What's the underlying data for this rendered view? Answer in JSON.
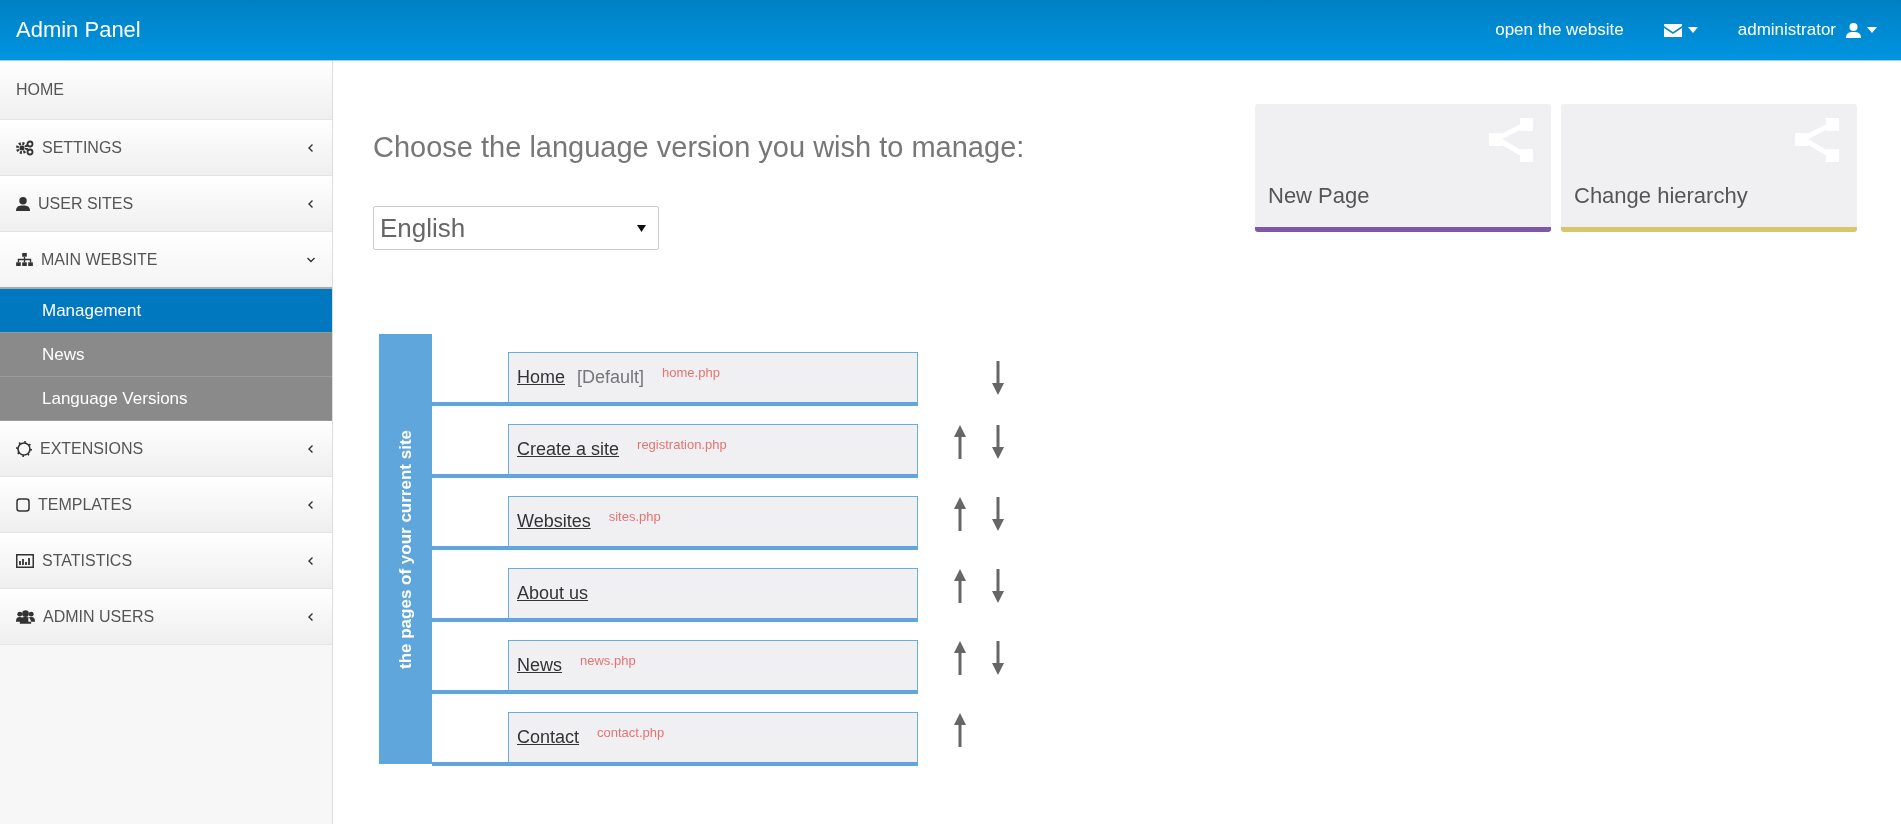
{
  "topbar": {
    "title": "Admin Panel",
    "website_link": "open the website",
    "user": "administrator"
  },
  "sidebar": {
    "items": [
      {
        "label": "HOME"
      },
      {
        "label": "SETTINGS",
        "expanded": false
      },
      {
        "label": "USER SITES",
        "expanded": false
      },
      {
        "label": "MAIN WEBSITE",
        "expanded": true,
        "children": [
          {
            "label": "Management",
            "selected": true
          },
          {
            "label": "News",
            "selected": false
          },
          {
            "label": "Language Versions",
            "selected": false
          }
        ]
      },
      {
        "label": "EXTENSIONS",
        "expanded": false
      },
      {
        "label": "TEMPLATES",
        "expanded": false
      },
      {
        "label": "STATISTICS",
        "expanded": false
      },
      {
        "label": "ADMIN USERS",
        "expanded": false
      }
    ]
  },
  "main": {
    "heading": "Choose the language version you wish to manage:",
    "language_select": {
      "value": "English"
    },
    "tiles": [
      {
        "label": "New Page",
        "color": "#7e57a6"
      },
      {
        "label": "Change hierarchy",
        "color": "#d9c66b"
      }
    ],
    "tree": {
      "caption": "the pages of your current site",
      "pages": [
        {
          "name": "Home",
          "note": "[Default]",
          "file": "home.php",
          "move_up": false,
          "move_down": true
        },
        {
          "name": "Create a site",
          "file": "registration.php",
          "move_up": true,
          "move_down": true
        },
        {
          "name": "Websites",
          "file": "sites.php",
          "move_up": true,
          "move_down": true
        },
        {
          "name": "About us",
          "move_up": true,
          "move_down": true
        },
        {
          "name": "News",
          "file": "news.php",
          "move_up": true,
          "move_down": true
        },
        {
          "name": "Contact",
          "file": "contact.php",
          "move_up": true,
          "move_down": false
        }
      ]
    }
  }
}
